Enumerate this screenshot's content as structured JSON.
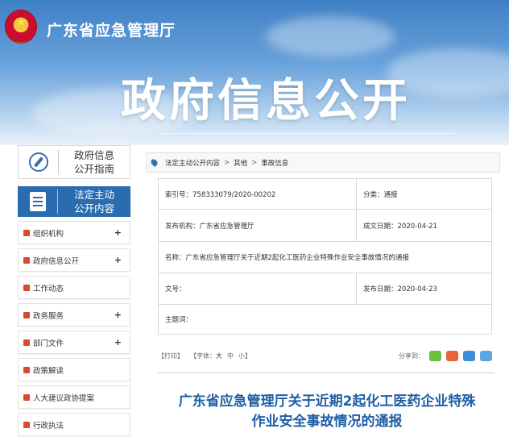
{
  "header": {
    "site_name": "广东省应急管理厅",
    "banner_title": "政府信息公开"
  },
  "sidebar": {
    "guide_line1": "政府信息",
    "guide_line2": "公开指南",
    "active_line1": "法定主动",
    "active_line2": "公开内容",
    "items": [
      {
        "label": "组织机构",
        "plus": "+"
      },
      {
        "label": "政府信息公开",
        "plus": "+"
      },
      {
        "label": "工作动态",
        "plus": ""
      },
      {
        "label": "政务服务",
        "plus": "+"
      },
      {
        "label": "部门文件",
        "plus": "+"
      },
      {
        "label": "政策解读",
        "plus": ""
      },
      {
        "label": "人大建议政协提案",
        "plus": ""
      },
      {
        "label": "行政执法",
        "plus": ""
      }
    ]
  },
  "breadcrumb": {
    "items": [
      "法定主动公开内容",
      "其他",
      "事故信息"
    ],
    "sep": ">"
  },
  "meta": {
    "index_label": "索引号：",
    "index_value": "758333079/2020-00202",
    "category_label": "分类：",
    "category_value": "通报",
    "issuer_label": "发布机构：",
    "issuer_value": "广东省应急管理厅",
    "created_label": "成文日期：",
    "created_value": "2020-04-21",
    "name_label": "名称：",
    "name_value": "广东省应急管理厅关于近期2起化工医药企业特殊作业安全事故情况的通报",
    "docno_label": "文号：",
    "docno_value": "",
    "published_label": "发布日期：",
    "published_value": "2020-04-23",
    "keywords_label": "主题词：",
    "keywords_value": ""
  },
  "toolbar": {
    "print": "【打印】",
    "font_label": "【字体：",
    "font_large": "大",
    "font_medium": "中",
    "font_small": "小】",
    "share_label": "分享到：",
    "share_colors": [
      "#6cbf3a",
      "#e8623a",
      "#3b8fd6",
      "#5aa6e0"
    ]
  },
  "article": {
    "title_line1": "广东省应急管理厅关于近期2起化工医药企业特殊",
    "title_line2": "作业安全事故情况的通报"
  }
}
